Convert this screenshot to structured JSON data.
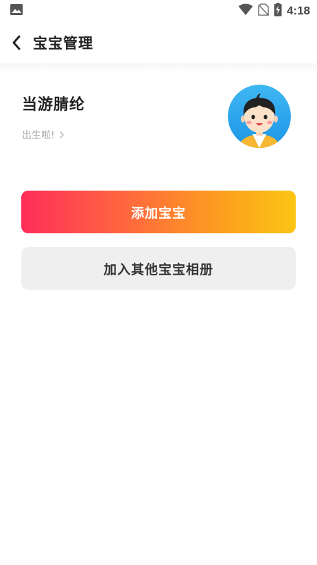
{
  "status_bar": {
    "time": "4:18",
    "icons": [
      "image-icon",
      "wifi-icon",
      "no-sim-icon",
      "battery-charging-icon"
    ]
  },
  "header": {
    "title": "宝宝管理",
    "back_icon": "chevron-left-icon"
  },
  "baby": {
    "name": "当游腈纶",
    "status": "出生啦!",
    "chevron_icon": "chevron-right-icon",
    "avatar_icon": "baby-avatar-icon"
  },
  "actions": {
    "add_baby": "添加宝宝",
    "join_album": "加入其他宝宝相册"
  },
  "colors": {
    "gradient_start": "#ff2d5a",
    "gradient_end": "#fcc514",
    "secondary_bg": "#efefef",
    "avatar_bg": "#29a8ef"
  }
}
